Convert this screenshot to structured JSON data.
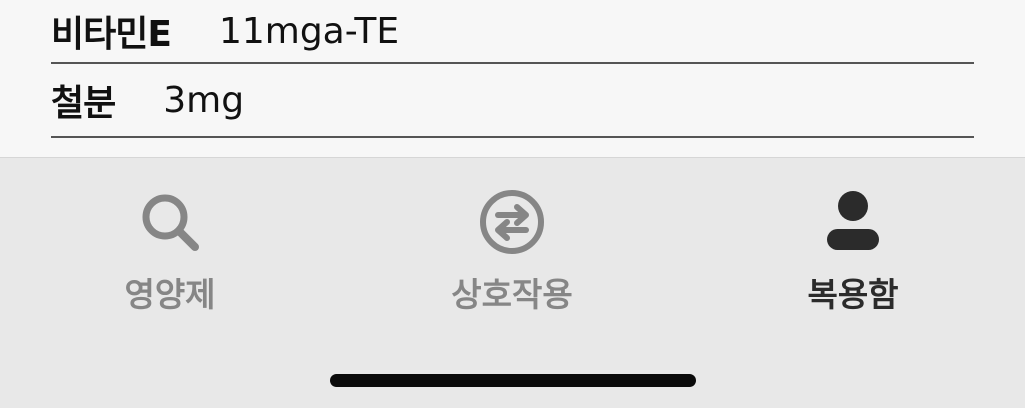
{
  "nutrients": [
    {
      "name": "비타민E",
      "value": "11mga-TE"
    },
    {
      "name": "철분",
      "value": "3mg"
    }
  ],
  "tabbar": {
    "tabs": [
      {
        "label": "영양제",
        "icon": "search-icon",
        "active": false
      },
      {
        "label": "상호작용",
        "icon": "swap-icon",
        "active": false
      },
      {
        "label": "복용함",
        "icon": "person-icon",
        "active": true
      }
    ],
    "colors": {
      "inactive": "#868686",
      "active": "#2b2b2b"
    }
  }
}
